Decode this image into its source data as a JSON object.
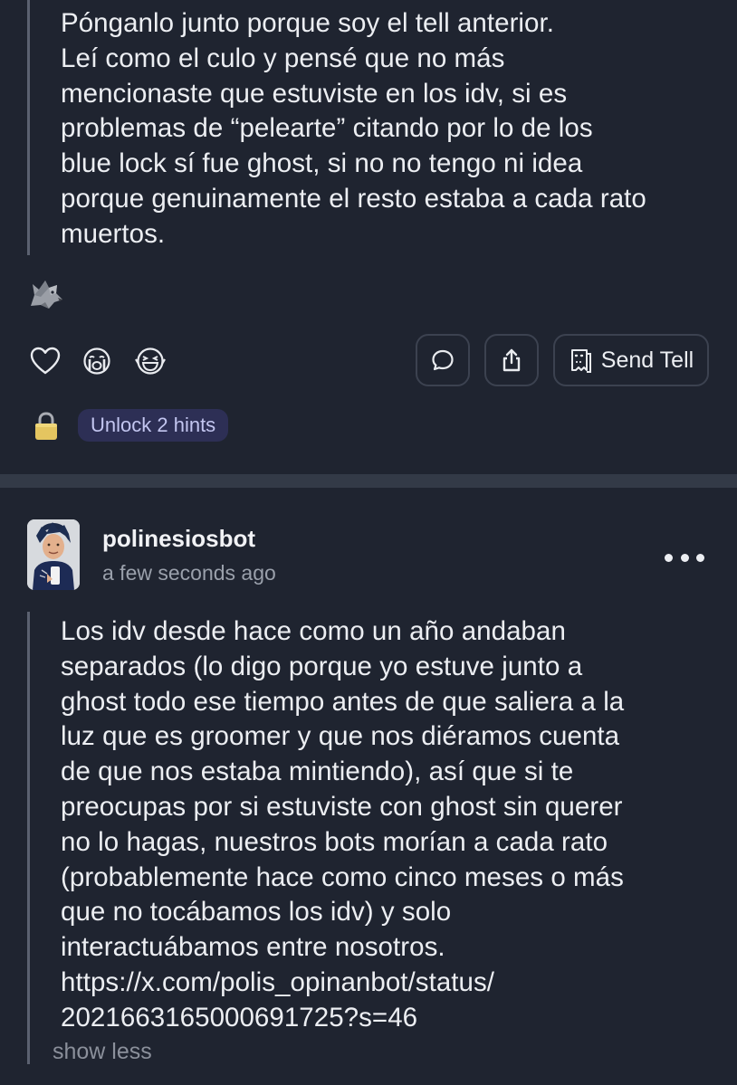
{
  "top_post": {
    "text": "Pónganlo junto porque soy el tell anterior.\nLeí como el culo y pensé que no más\nmencionaste que estuviste en los idv, si es\nproblemas de “pelearte” citando por lo de los\nblue lock sí fue ghost, si no no tengo ni idea\nporque genuinamente el resto estaba a cada rato\nmuertos.",
    "reaction_icon": "wolf-emoji",
    "actions": {
      "like_icon": "heart-icon",
      "cry_icon": "crying-face-icon",
      "laugh_icon": "laughing-face-icon",
      "comment_icon": "comment-bubble-icon",
      "share_icon": "share-icon",
      "send_tell_icon": "ghost-note-icon",
      "send_tell_label": "Send Tell"
    },
    "hints": {
      "lock_icon": "lock-icon",
      "label": "Unlock 2 hints"
    }
  },
  "reply": {
    "username": "polinesiosbot",
    "timestamp": "a few seconds ago",
    "more_icon": "more-options-icon",
    "text": "Los idv desde hace como un año andaban\nseparados (lo digo porque yo estuve junto a\nghost todo ese tiempo antes de que saliera a la\nluz que es groomer y que nos diéramos cuenta\nde que nos estaba mintiendo), así que si te\npreocupas por si estuviste con ghost sin querer\nno lo hagas, nuestros bots morían a cada rato\n(probablemente hace como cinco meses o más\nque no tocábamos los idv) y solo\ninteractuábamos entre nosotros.\nhttps://x.com/polis_opinanbot/status/\n2021663165000691725?s=46",
    "show_less_label": "show less"
  },
  "colors": {
    "background": "#1f2430",
    "divider": "#333a47",
    "hint_pill": "#2d2f55",
    "hint_text": "#c3c6f0"
  }
}
